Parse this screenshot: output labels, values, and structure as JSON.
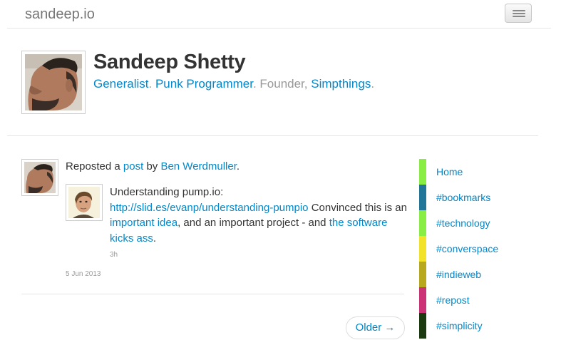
{
  "site": {
    "brand": "sandeep.io"
  },
  "profile": {
    "name": "Sandeep Shetty",
    "tagline": {
      "part1": "Generalist",
      "sep1": ".",
      "part2": "Punk Programmer",
      "sep2": ". Founder,",
      "part3": "Simpthings",
      "sep3": "."
    }
  },
  "post": {
    "repost_prefix": "Reposted a",
    "repost_link": "post",
    "repost_by": "by",
    "repost_author": "Ben Werdmuller",
    "repost_end": ".",
    "title": "Understanding pump.io:",
    "url": "http://slid.es/evanp/understanding-pumpio",
    "text1": "Convinced this is an",
    "link1": "important idea",
    "text2": ", and an important project - and",
    "link2": "the software kicks ass",
    "text3": ".",
    "inner_time": "3h",
    "date": "5 Jun 2013"
  },
  "pagination": {
    "older_label": "Older →"
  },
  "sidebar": {
    "items": [
      {
        "label": "Home",
        "color": "#88ee44"
      },
      {
        "label": "#bookmarks",
        "color": "#227799"
      },
      {
        "label": "#technology",
        "color": "#88ee44"
      },
      {
        "label": "#converspace",
        "color": "#f2e22a"
      },
      {
        "label": "#indieweb",
        "color": "#b8a820"
      },
      {
        "label": "#repost",
        "color": "#cc3377"
      },
      {
        "label": "#simplicity",
        "color": "#1c3a10"
      }
    ]
  },
  "colors": {
    "link": "#0088cc",
    "muted": "#999999",
    "text": "#333333"
  }
}
